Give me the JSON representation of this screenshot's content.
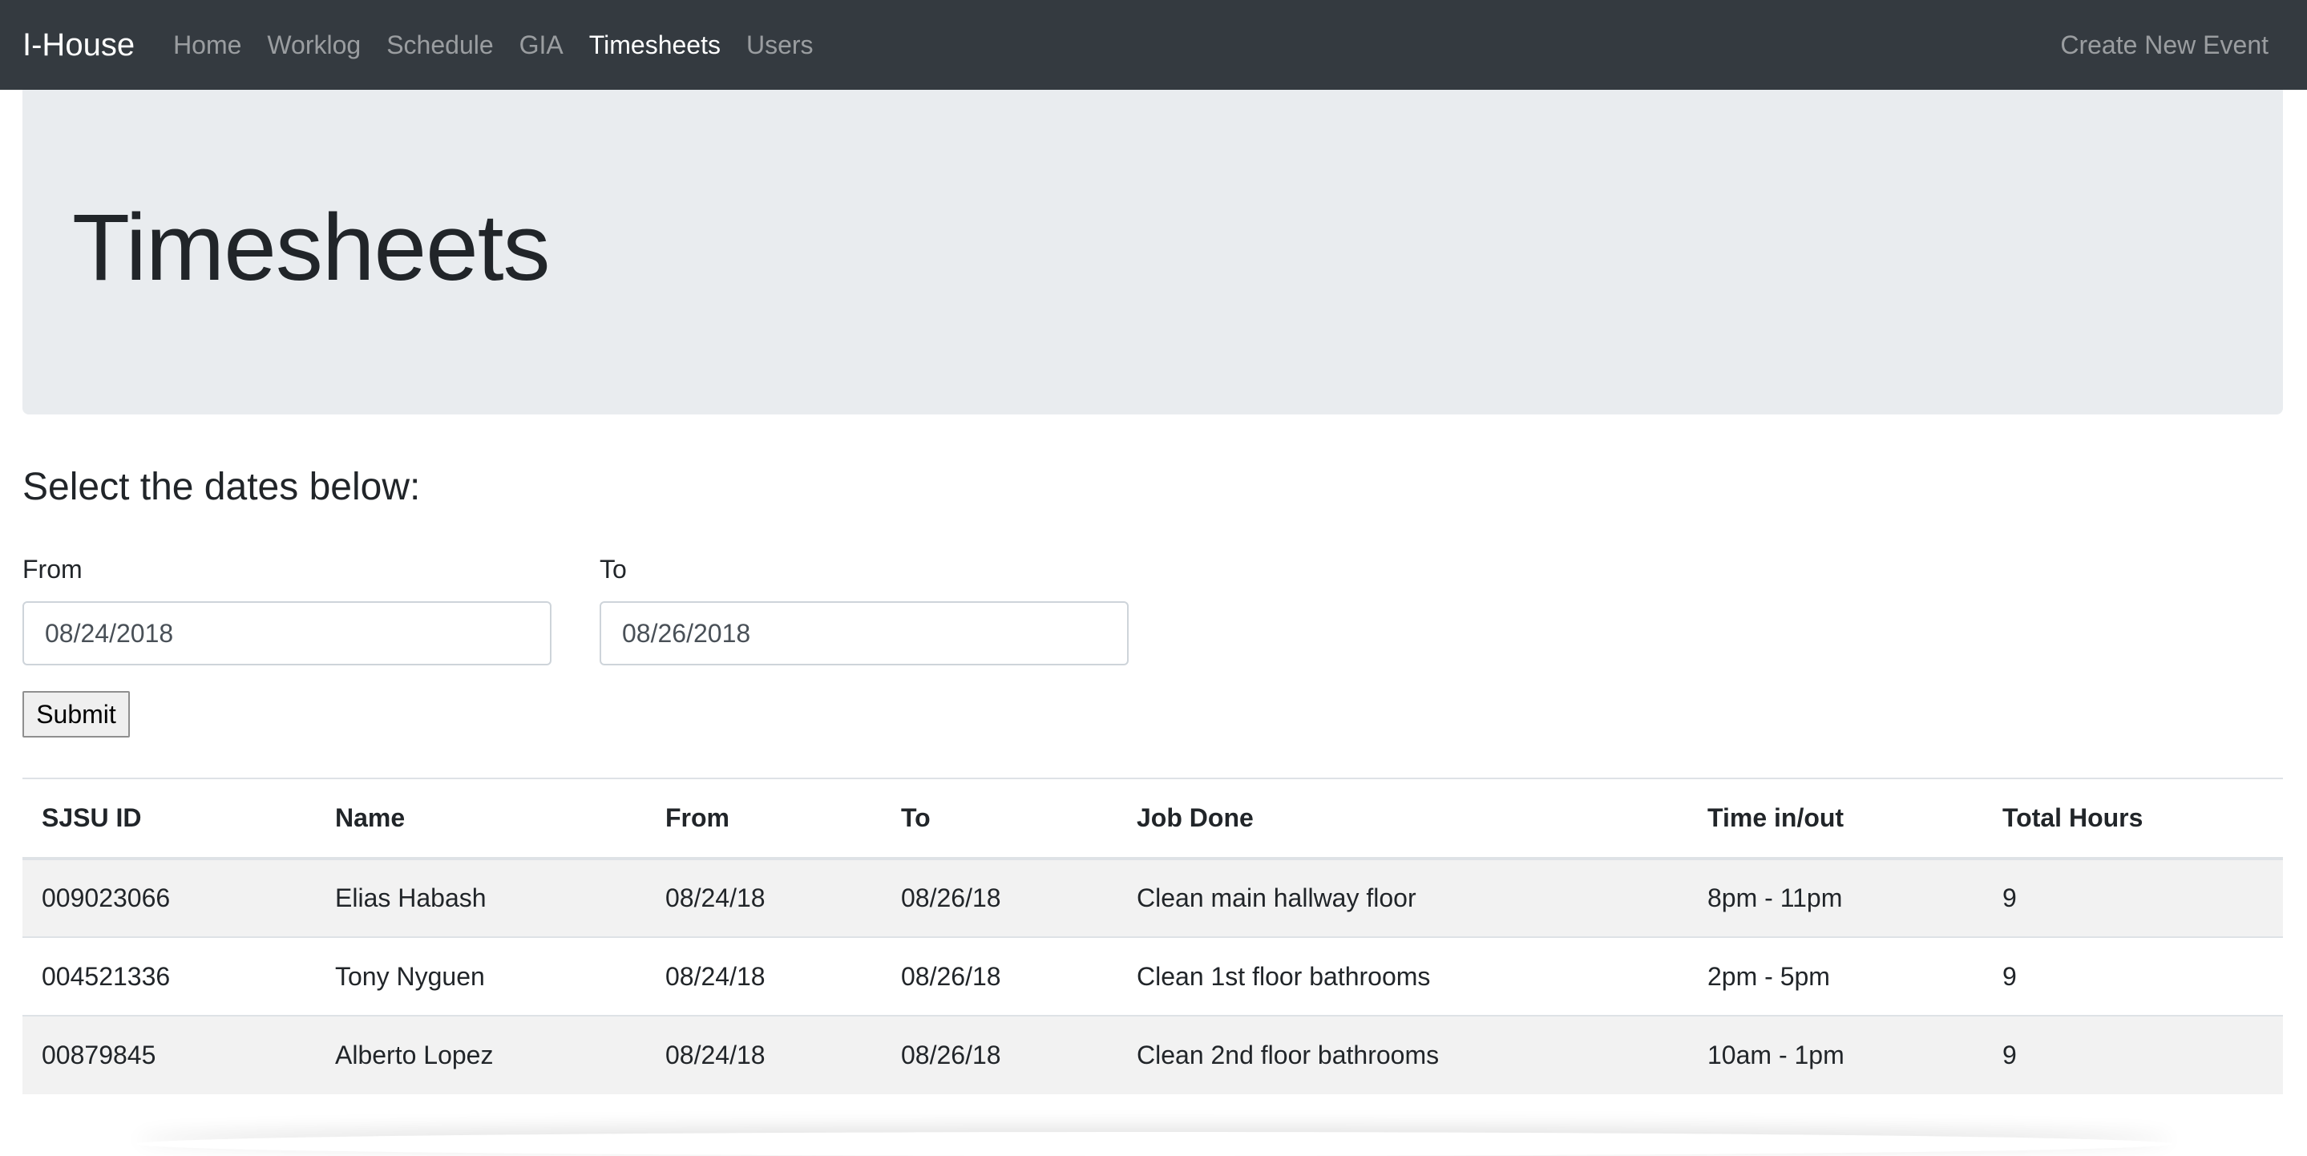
{
  "navbar": {
    "brand": "I-House",
    "links": [
      {
        "label": "Home",
        "active": false
      },
      {
        "label": "Worklog",
        "active": false
      },
      {
        "label": "Schedule",
        "active": false
      },
      {
        "label": "GIA",
        "active": false
      },
      {
        "label": "Timesheets",
        "active": true
      },
      {
        "label": "Users",
        "active": false
      }
    ],
    "right_link": "Create New Event"
  },
  "jumbotron": {
    "title": "Timesheets"
  },
  "form": {
    "heading": "Select the dates below:",
    "from_label": "From",
    "from_value": "08/24/2018",
    "to_label": "To",
    "to_value": "08/26/2018",
    "submit_label": "Submit"
  },
  "table": {
    "headers": [
      "SJSU ID",
      "Name",
      "From",
      "To",
      "Job Done",
      "Time in/out",
      "Total Hours"
    ],
    "rows": [
      [
        "009023066",
        "Elias Habash",
        "08/24/18",
        "08/26/18",
        "Clean main hallway floor",
        "8pm - 11pm",
        "9"
      ],
      [
        "004521336",
        "Tony Nyguen",
        "08/24/18",
        "08/26/18",
        "Clean 1st floor bathrooms",
        "2pm - 5pm",
        "9"
      ],
      [
        "00879845",
        "Alberto Lopez",
        "08/24/18",
        "08/26/18",
        "Clean 2nd floor bathrooms",
        "10am - 1pm",
        "9"
      ]
    ]
  }
}
